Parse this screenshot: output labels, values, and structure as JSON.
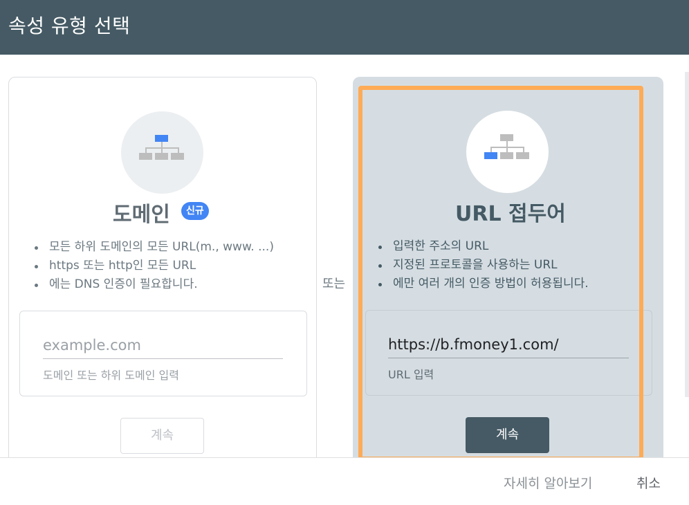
{
  "header": {
    "title": "속성 유형 선택"
  },
  "domain_card": {
    "title": "도메인",
    "badge": "신규",
    "features": [
      "모든 하위 도메인의 모든 URL(m., www. ...)",
      "https 또는 http인 모든 URL",
      "에는 DNS 인증이 필요합니다."
    ],
    "input": {
      "placeholder": "example.com",
      "hint": "도메인 또는 하위 도메인 입력"
    },
    "button_label": "계속",
    "icon": "sitemap-icon"
  },
  "separator": {
    "label": "또는"
  },
  "url_card": {
    "title": "URL 접두어",
    "features": [
      "입력한 주소의 URL",
      "지정된 프로토콜을 사용하는 URL",
      "에만 여러 개의 인증 방법이 허용됩니다."
    ],
    "input": {
      "value": "https://b.fmoney1.com/",
      "hint": "URL 입력"
    },
    "button_label": "계속",
    "icon": "sitemap-icon"
  },
  "footer": {
    "learn_more": "자세히 알아보기",
    "cancel": "취소"
  },
  "colors": {
    "header_bg": "#455a64",
    "accent_blue": "#4285f4",
    "highlight_orange": "#ffab56",
    "selected_card_bg": "#d5dde2"
  }
}
